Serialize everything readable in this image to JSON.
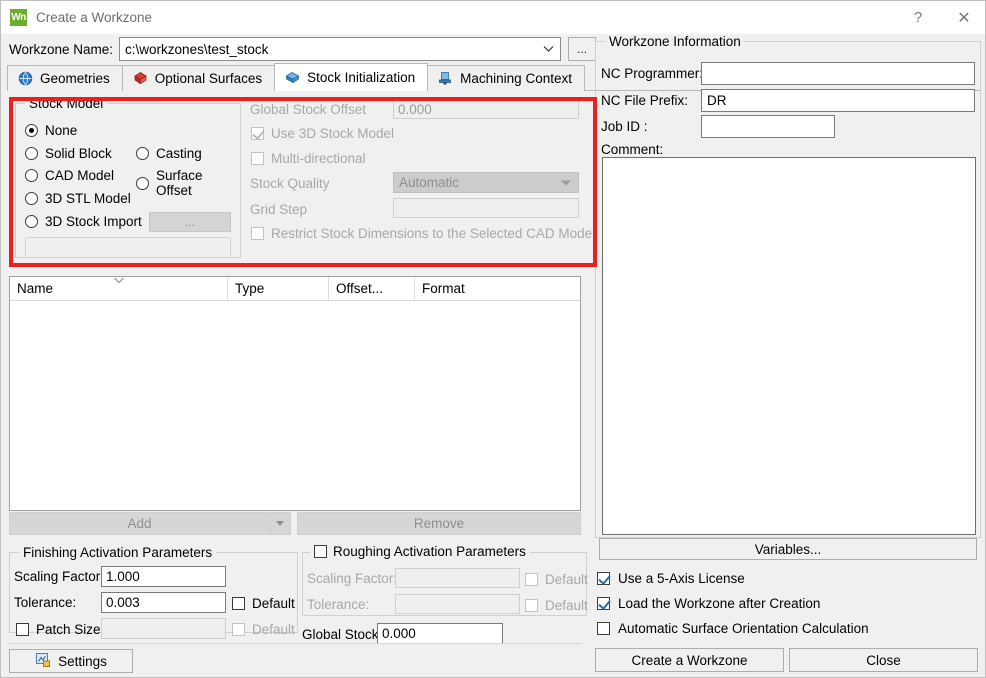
{
  "window": {
    "app_icon_text": "Wn",
    "title": "Create a Workzone",
    "help_glyph": "?",
    "close_glyph": "✕",
    "accent_red": "#e8201f",
    "app_icon_color": "#6aae2e",
    "check_color": "#2a6ea8"
  },
  "workzone_name": {
    "label": "Workzone Name:",
    "value": "c:\\workzones\\test_stock",
    "browse_label": "...",
    "dropdown_glyph": "⌄"
  },
  "tabs": [
    {
      "label": "Geometries",
      "icon": "globe-icon",
      "active": false
    },
    {
      "label": "Optional Surfaces",
      "icon": "red-surface-icon",
      "active": false
    },
    {
      "label": "Stock Initialization",
      "icon": "blue-block-icon",
      "active": true
    },
    {
      "label": "Machining Context",
      "icon": "machine-icon",
      "active": false
    }
  ],
  "stock_model": {
    "title": "Stock Model",
    "options": [
      {
        "label": "None",
        "checked": true
      },
      {
        "label": "Solid Block",
        "checked": false
      },
      {
        "label": "Casting",
        "checked": false
      },
      {
        "label": "CAD Model",
        "checked": false
      },
      {
        "label": "Surface Offset",
        "checked": false
      },
      {
        "label": "3D STL Model",
        "checked": false
      },
      {
        "label": "3D Stock Import",
        "checked": false
      }
    ],
    "import_button_label": "...",
    "path_field_value": ""
  },
  "stock_options": {
    "global_stock_offset_label": "Global Stock Offset",
    "global_stock_offset_value": "0.000",
    "use_3d_stock_model_label": "Use 3D Stock Model",
    "use_3d_stock_model_checked": true,
    "multi_directional_label": "Multi-directional",
    "multi_directional_checked": false,
    "stock_quality_label": "Stock Quality",
    "stock_quality_value": "Automatic",
    "grid_step_label": "Grid Step",
    "grid_step_value": "",
    "restrict_label": "Restrict Stock Dimensions to the Selected CAD Model",
    "restrict_checked": false
  },
  "table": {
    "columns": [
      {
        "label": "Name",
        "sorted": true,
        "sort_glyph": "⌄"
      },
      {
        "label": "Type",
        "sorted": false
      },
      {
        "label": "Offset...",
        "sorted": false
      },
      {
        "label": "Format",
        "sorted": false
      }
    ],
    "rows": []
  },
  "list_buttons": {
    "add_label": "Add",
    "add_dropdown_glyph": "▾",
    "remove_label": "Remove"
  },
  "finishing": {
    "title": "Finishing Activation Parameters",
    "scaling_factor_label": "Scaling Factor:",
    "scaling_factor_value": "1.000",
    "tolerance_label": "Tolerance:",
    "tolerance_value": "0.003",
    "tolerance_default_label": "Default",
    "tolerance_default_checked": false,
    "patch_size_label": "Patch Size",
    "patch_size_checked": false,
    "patch_size_value": "",
    "patch_default_label": "Default",
    "patch_default_checked": false
  },
  "roughing": {
    "title": "Roughing Activation Parameters",
    "enabled_checked": false,
    "scaling_factor_label": "Scaling Factor:",
    "scaling_factor_value": "",
    "scaling_default_label": "Default",
    "scaling_default_checked": false,
    "tolerance_label": "Tolerance:",
    "tolerance_value": "",
    "tolerance_default_label": "Default",
    "tolerance_default_checked": false
  },
  "global_stock": {
    "label": "Global Stock:",
    "value": "0.000"
  },
  "settings": {
    "label": "Settings",
    "icon": "settings-icon"
  },
  "workzone_information": {
    "title": "Workzone Information",
    "nc_programmer_label": "NC Programmer:",
    "nc_programmer_value": "",
    "nc_file_prefix_label": "NC File Prefix:",
    "nc_file_prefix_value": "DR",
    "job_id_label": "Job ID :",
    "job_id_value": "",
    "comment_label": "Comment:",
    "comment_value": "",
    "variables_label": "Variables..."
  },
  "right_checkboxes": [
    {
      "label": "Use a 5-Axis License",
      "checked": true
    },
    {
      "label": "Load the Workzone after Creation",
      "checked": true
    },
    {
      "label": "Automatic Surface Orientation Calculation",
      "checked": false
    }
  ],
  "footer": {
    "create_label": "Create a Workzone",
    "close_label": "Close"
  }
}
